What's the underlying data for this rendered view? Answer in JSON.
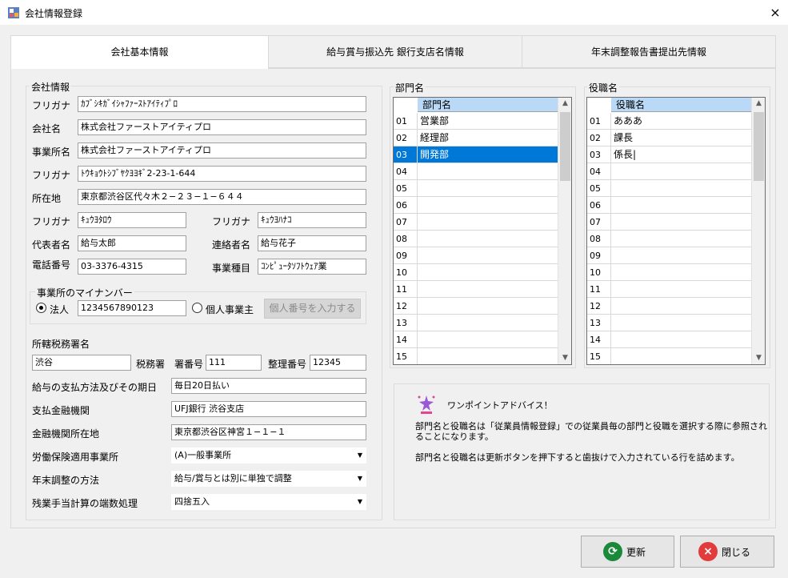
{
  "window": {
    "title": "会社情報登録",
    "close_icon": "×"
  },
  "tabs": [
    {
      "label": "会社基本情報",
      "active": true
    },
    {
      "label": "給与賞与振込先 銀行支店名情報",
      "active": false
    },
    {
      "label": "年末調整報告書提出先情報",
      "active": false
    }
  ],
  "company": {
    "group_title": "会社情報",
    "furigana1_label": "フリガナ",
    "furigana1_value": "ｶﾌﾞｼｷｶﾞｲｼｬﾌｧｰｽﾄｱｲﾃｨﾌﾟﾛ",
    "name_label": "会社名",
    "name_value": "株式会社ファーストアイティプロ",
    "office_label": "事業所名",
    "office_value": "株式会社ファーストアイティプロ",
    "furigana2_label": "フリガナ",
    "furigana2_value": "ﾄｳｷｮｳﾄｼﾌﾞﾔｸﾖﾖｷﾞ2-23-1-644",
    "address_label": "所在地",
    "address_value": "東京都渋谷区代々木２−２３−１−６４４",
    "rep_furigana_label": "フリガナ",
    "rep_furigana_value": "ｷｭｳﾖﾀﾛｳ",
    "contact_furigana_label": "フリガナ",
    "contact_furigana_value": "ｷｭｳﾖﾊﾅｺ",
    "rep_label": "代表者名",
    "rep_value": "給与太郎",
    "contact_label": "連絡者名",
    "contact_value": "給与花子",
    "phone_label": "電話番号",
    "phone_value": "03-3376-4315",
    "business_label": "事業種目",
    "business_value": "ｺﾝﾋﾟｭｰﾀｿﾌﾄｳｪｱ業"
  },
  "mynumber": {
    "group_title": "事業所のマイナンバー",
    "corp_label": "法人",
    "corp_value": "1234567890123",
    "indiv_label": "個人事業主",
    "input_button": "個人番号を入力する"
  },
  "tax": {
    "section_title": "所轄税務署名",
    "office_value": "渋谷",
    "office_suffix": "税務署",
    "code_label": "署番号",
    "code_value": "111",
    "ref_label": "整理番号",
    "ref_value": "12345"
  },
  "payment": {
    "method_label": "給与の支払方法及びその期日",
    "method_value": "毎日20日払い",
    "bank_label": "支払金融機関",
    "bank_value": "UFJ銀行 渋谷支店",
    "bank_addr_label": "金融機関所在地",
    "bank_addr_value": "東京都渋谷区神宮１−１−１",
    "labor_label": "労働保険適用事業所",
    "labor_value": "(A)一般事業所",
    "yearend_label": "年末調整の方法",
    "yearend_value": "給与/賞与とは別に単独で調整",
    "overtime_label": "残業手当計算の端数処理",
    "overtime_value": "四捨五入"
  },
  "departments": {
    "group_title": "部門名",
    "column_header": "部門名",
    "selected_row": 2,
    "rows": [
      {
        "no": "01",
        "name": "営業部"
      },
      {
        "no": "02",
        "name": "経理部"
      },
      {
        "no": "03",
        "name": "開発部"
      },
      {
        "no": "04",
        "name": ""
      },
      {
        "no": "05",
        "name": ""
      },
      {
        "no": "06",
        "name": ""
      },
      {
        "no": "07",
        "name": ""
      },
      {
        "no": "08",
        "name": ""
      },
      {
        "no": "09",
        "name": ""
      },
      {
        "no": "10",
        "name": ""
      },
      {
        "no": "11",
        "name": ""
      },
      {
        "no": "12",
        "name": ""
      },
      {
        "no": "13",
        "name": ""
      },
      {
        "no": "14",
        "name": ""
      },
      {
        "no": "15",
        "name": ""
      }
    ]
  },
  "positions": {
    "group_title": "役職名",
    "column_header": "役職名",
    "rows": [
      {
        "no": "01",
        "name": "あああ"
      },
      {
        "no": "02",
        "name": "課長"
      },
      {
        "no": "03",
        "name": "係長|"
      },
      {
        "no": "04",
        "name": ""
      },
      {
        "no": "05",
        "name": ""
      },
      {
        "no": "06",
        "name": ""
      },
      {
        "no": "07",
        "name": ""
      },
      {
        "no": "08",
        "name": ""
      },
      {
        "no": "09",
        "name": ""
      },
      {
        "no": "10",
        "name": ""
      },
      {
        "no": "11",
        "name": ""
      },
      {
        "no": "12",
        "name": ""
      },
      {
        "no": "13",
        "name": ""
      },
      {
        "no": "14",
        "name": ""
      },
      {
        "no": "15",
        "name": ""
      }
    ]
  },
  "advice": {
    "title": "ワンポイントアドバイス！",
    "p1_line1": "部門名と役職名は「従業員情報登録」での従業員毎の部門と役職を選択する際に参照され",
    "p1_line2": "ることになります。",
    "p2": "部門名と役職名は更新ボタンを押下すると歯抜けで入力されている行を詰めます。"
  },
  "buttons": {
    "update": "更新",
    "close": "閉じる"
  },
  "colors": {
    "selection": "#0078d7",
    "grid_header": "#b9d9f7",
    "update_icon": "#1a8a3a",
    "close_icon": "#e23b3b"
  }
}
